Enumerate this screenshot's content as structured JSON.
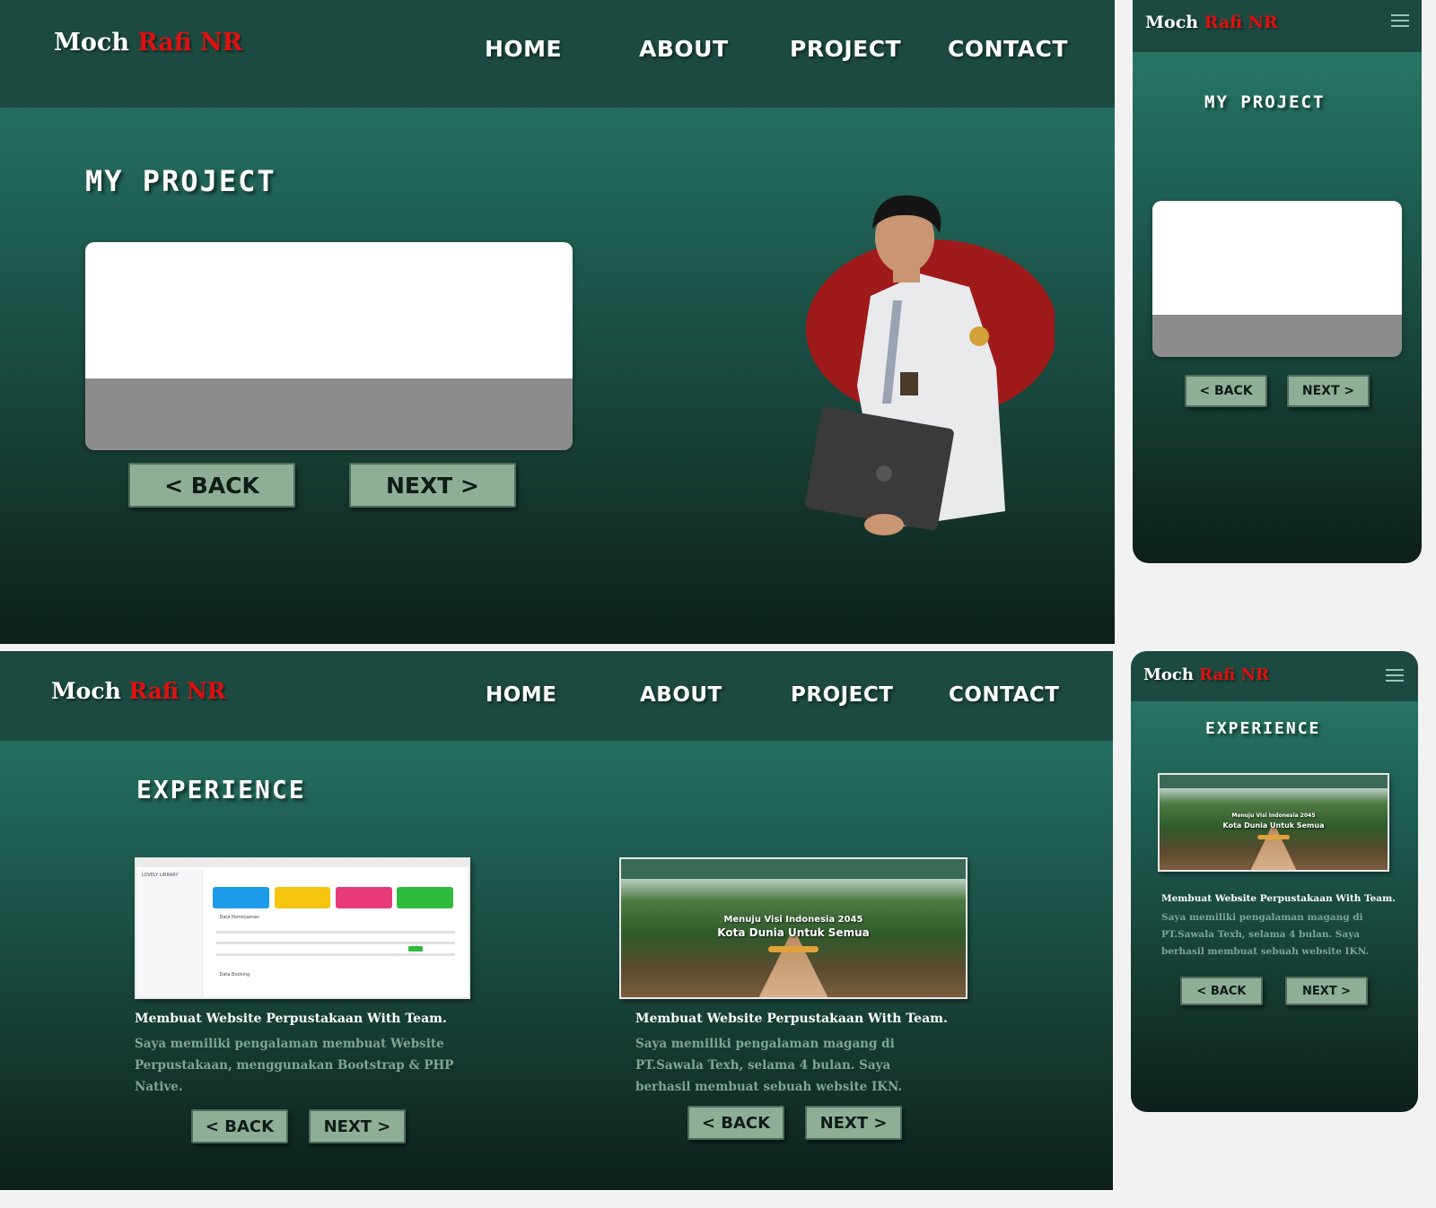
{
  "brand": {
    "first": "Moch",
    "accent": "Rafi NR",
    "accent_color": "#e01010"
  },
  "nav": {
    "home": "HOME",
    "about": "ABOUT",
    "project": "PROJECT",
    "contact": "CONTACT"
  },
  "menu_icon": "hamburger-menu-icon",
  "colors": {
    "navbar": "#1c4a40",
    "gradient_top": "#2a7d6c",
    "gradient_bottom": "#0d1f1a",
    "button": "#8fae98",
    "description_text": "#7fa595"
  },
  "project_section": {
    "title": "MY PROJECT",
    "back_label": "< BACK",
    "next_label": "NEXT >"
  },
  "experience_section": {
    "title": "EXPERIENCE",
    "items": [
      {
        "title": "Membuat Website Perpustakaan With Team.",
        "description": "Saya memiliki pengalaman membuat Website Perpustakaan, menggunakan Bootstrap  & PHP Native.",
        "screenshot": {
          "app_name": "LOVELY LIBRARY",
          "table_heading": "Data Peminjaman",
          "table_heading_2": "Data Booking"
        }
      },
      {
        "title": "Membuat Website Perpustakaan With Team.",
        "description": "Saya memiliki pengalaman magang di PT.Sawala Texh, selama 4 bulan. Saya berhasil membuat sebuah website IKN.",
        "screenshot": {
          "line1": "Menuju Visi Indonesia 2045",
          "line2": "Kota Dunia Untuk Semua"
        }
      }
    ],
    "back_label": "< BACK",
    "next_label": "NEXT >"
  }
}
